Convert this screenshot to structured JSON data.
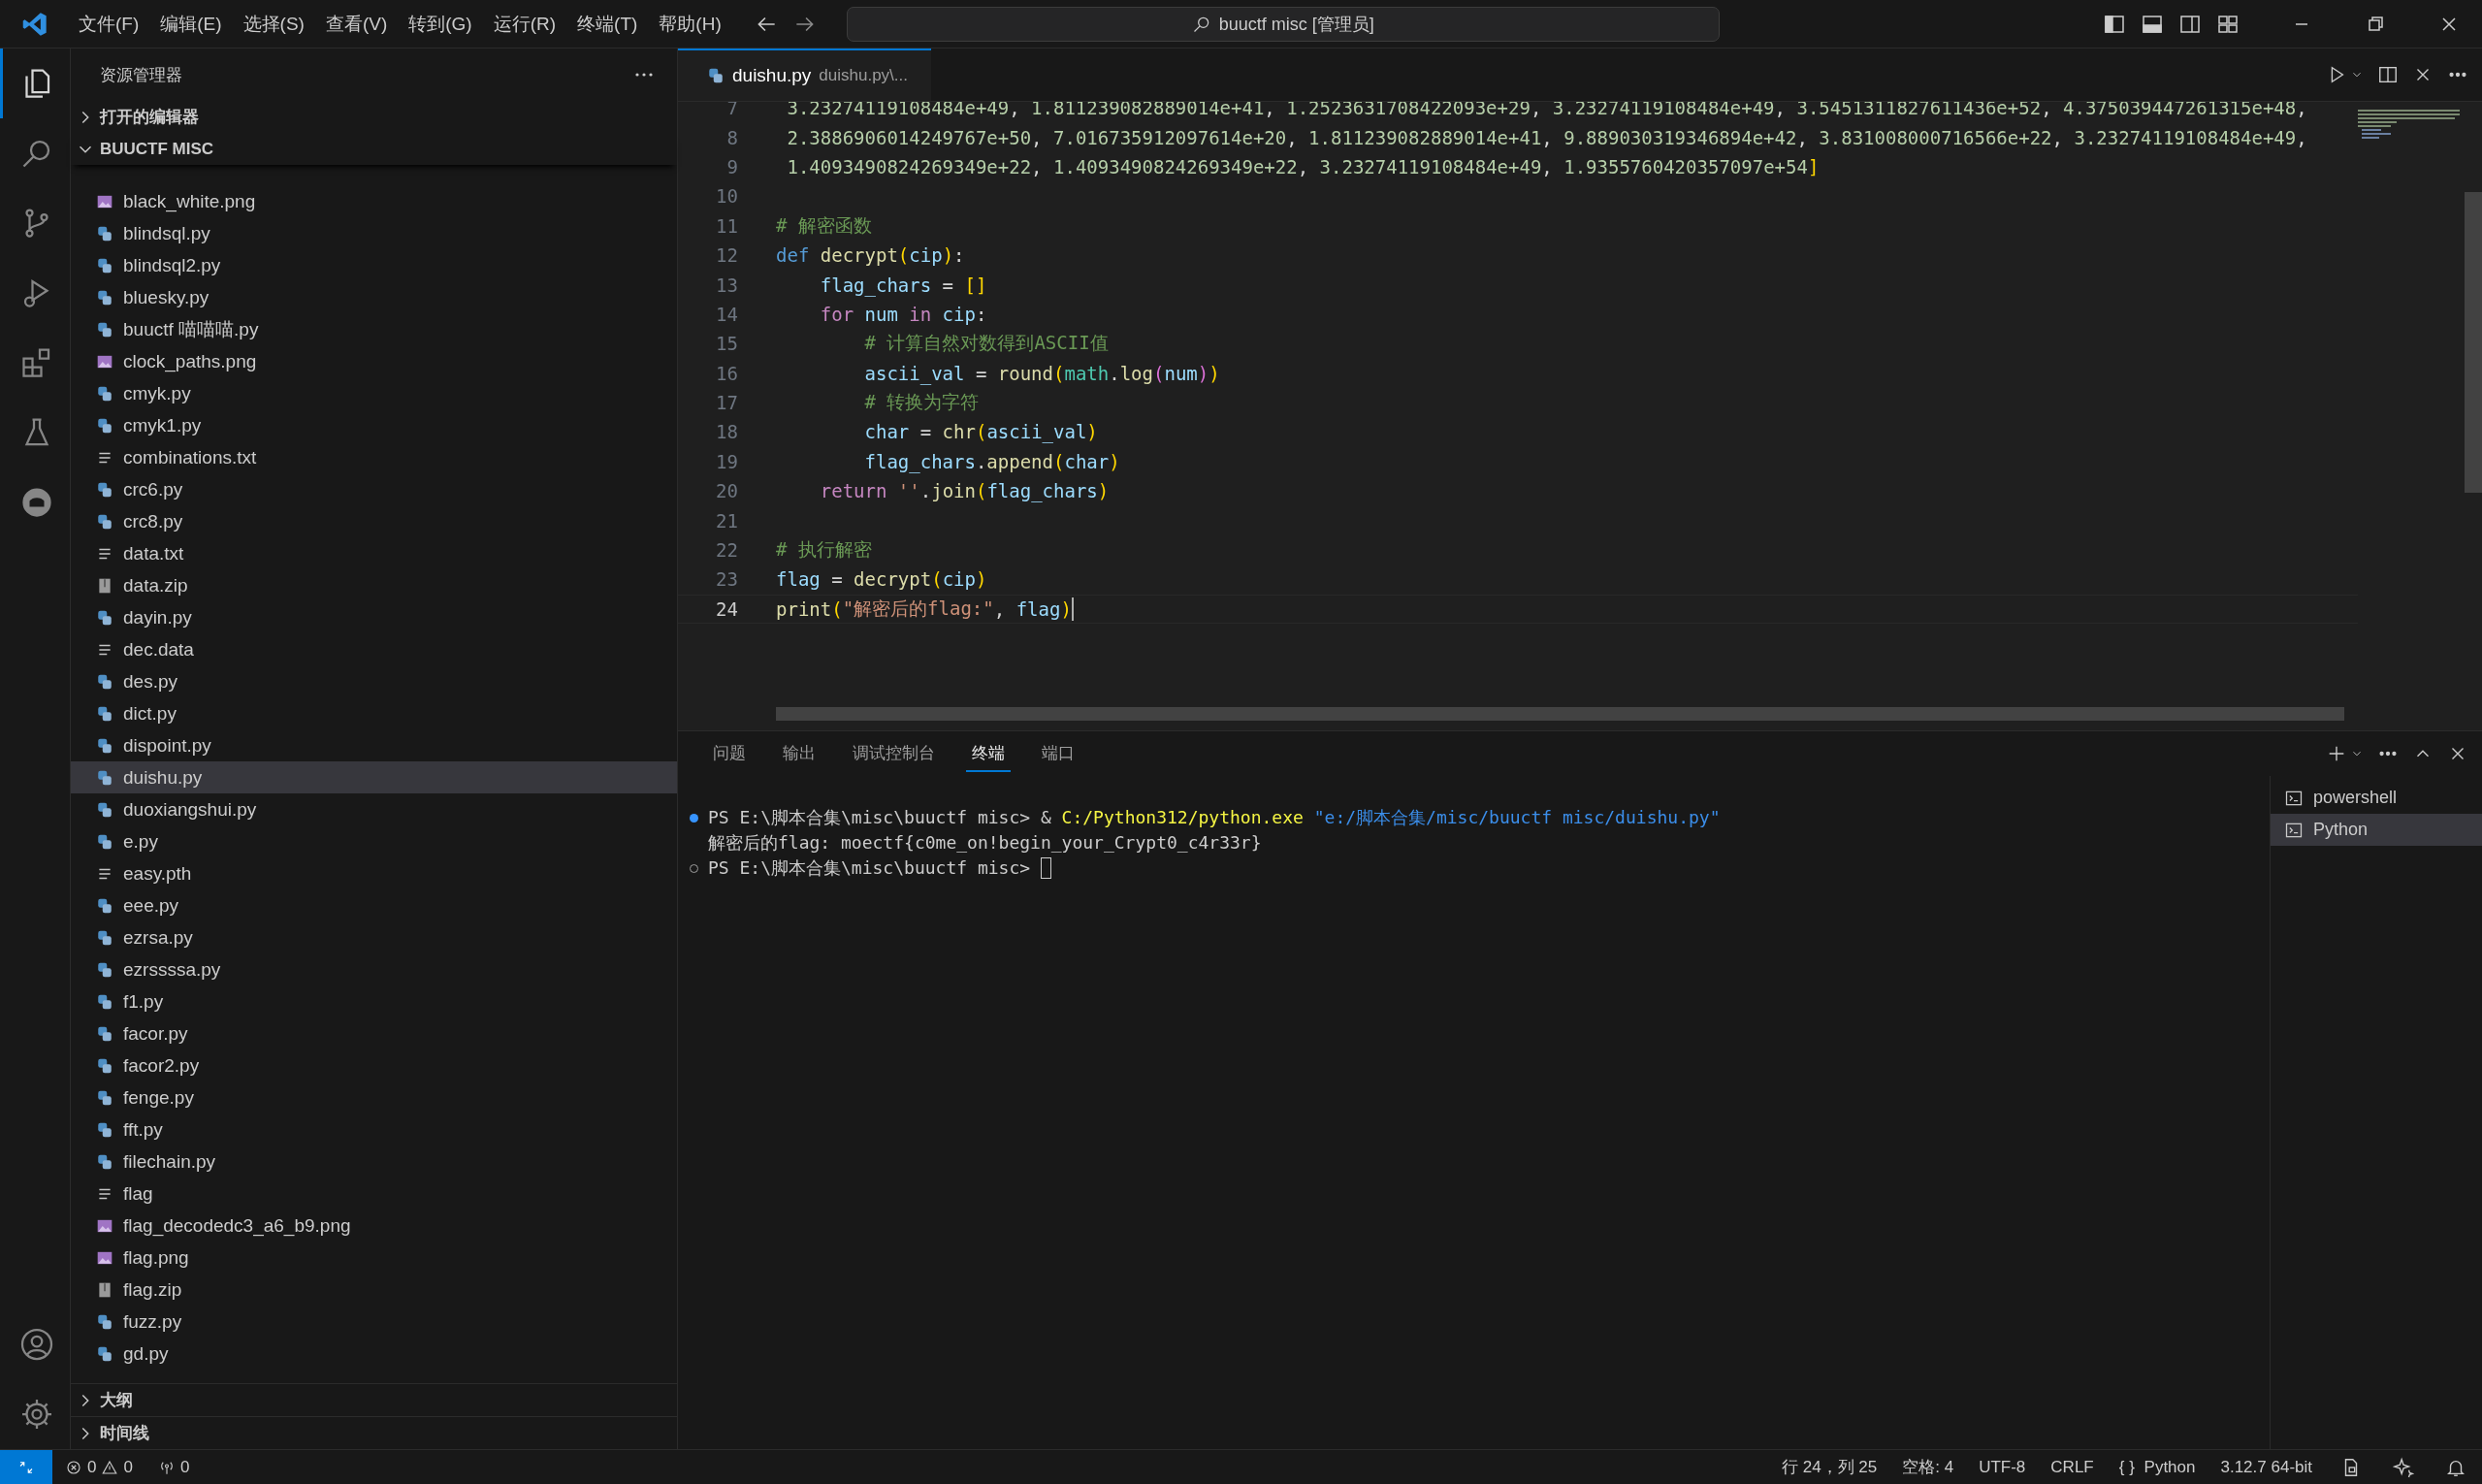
{
  "title_bar": {
    "menu": [
      "文件(F)",
      "编辑(E)",
      "选择(S)",
      "查看(V)",
      "转到(G)",
      "运行(R)",
      "终端(T)",
      "帮助(H)"
    ],
    "search": "buuctf misc [管理员]"
  },
  "activity_bar": {
    "items": [
      {
        "selected": true
      },
      {
        "selected": false
      },
      {
        "selected": false
      },
      {
        "selected": false
      },
      {
        "selected": false
      },
      {
        "selected": false
      },
      {
        "selected": false
      }
    ]
  },
  "sidebar": {
    "title": "资源管理器",
    "sections": [
      {
        "label": "打开的编辑器",
        "expanded": false
      },
      {
        "label": "BUUCTF MISC",
        "expanded": true
      }
    ],
    "files": [
      {
        "name": "black_white.png",
        "kind": "png",
        "selected": false
      },
      {
        "name": "blindsql.py",
        "kind": "py",
        "selected": false
      },
      {
        "name": "blindsql2.py",
        "kind": "py",
        "selected": false
      },
      {
        "name": "bluesky.py",
        "kind": "py",
        "selected": false
      },
      {
        "name": "buuctf 喵喵喵.py",
        "kind": "py",
        "selected": false
      },
      {
        "name": "clock_paths.png",
        "kind": "png",
        "selected": false
      },
      {
        "name": "cmyk.py",
        "kind": "py",
        "selected": false
      },
      {
        "name": "cmyk1.py",
        "kind": "py",
        "selected": false
      },
      {
        "name": "combinations.txt",
        "kind": "txt",
        "selected": false
      },
      {
        "name": "crc6.py",
        "kind": "py",
        "selected": false
      },
      {
        "name": "crc8.py",
        "kind": "py",
        "selected": false
      },
      {
        "name": "data.txt",
        "kind": "txt",
        "selected": false
      },
      {
        "name": "data.zip",
        "kind": "zip",
        "selected": false
      },
      {
        "name": "dayin.py",
        "kind": "py",
        "selected": false
      },
      {
        "name": "dec.data",
        "kind": "txt",
        "selected": false
      },
      {
        "name": "des.py",
        "kind": "py",
        "selected": false
      },
      {
        "name": "dict.py",
        "kind": "py",
        "selected": false
      },
      {
        "name": "dispoint.py",
        "kind": "py",
        "selected": false
      },
      {
        "name": "duishu.py",
        "kind": "py",
        "selected": true
      },
      {
        "name": "duoxiangshui.py",
        "kind": "py",
        "selected": false
      },
      {
        "name": "e.py",
        "kind": "py",
        "selected": false
      },
      {
        "name": "easy.pth",
        "kind": "txt",
        "selected": false
      },
      {
        "name": "eee.py",
        "kind": "py",
        "selected": false
      },
      {
        "name": "ezrsa.py",
        "kind": "py",
        "selected": false
      },
      {
        "name": "ezrssssa.py",
        "kind": "py",
        "selected": false
      },
      {
        "name": "f1.py",
        "kind": "py",
        "selected": false
      },
      {
        "name": "facor.py",
        "kind": "py",
        "selected": false
      },
      {
        "name": "facor2.py",
        "kind": "py",
        "selected": false
      },
      {
        "name": "fenge.py",
        "kind": "py",
        "selected": false
      },
      {
        "name": "fft.py",
        "kind": "py",
        "selected": false
      },
      {
        "name": "filechain.py",
        "kind": "py",
        "selected": false
      },
      {
        "name": "flag",
        "kind": "txt",
        "selected": false
      },
      {
        "name": "flag_decodedc3_a6_b9.png",
        "kind": "png",
        "selected": false
      },
      {
        "name": "flag.png",
        "kind": "png",
        "selected": false
      },
      {
        "name": "flag.zip",
        "kind": "zip",
        "selected": false
      },
      {
        "name": "fuzz.py",
        "kind": "py",
        "selected": false
      },
      {
        "name": "gd.py",
        "kind": "py",
        "selected": false
      }
    ],
    "bottom_sections": [
      {
        "label": "大纲",
        "expanded": false
      },
      {
        "label": "时间线",
        "expanded": false
      }
    ]
  },
  "editor": {
    "tab": {
      "label": "duishu.py",
      "description": "duishu.py\\...",
      "selected": true
    },
    "lines": [
      {
        "number": "7",
        "active": false,
        "tokens": [
          {
            "kind": "num",
            "text": " 3.23274119108484e+49"
          },
          {
            "kind": "plain",
            "text": ", "
          },
          {
            "kind": "num",
            "text": "1.811239082889014e+41"
          },
          {
            "kind": "plain",
            "text": ", "
          },
          {
            "kind": "num",
            "text": "1.2523631708422093e+29"
          },
          {
            "kind": "plain",
            "text": ", "
          },
          {
            "kind": "num",
            "text": "3.23274119108484e+49"
          },
          {
            "kind": "plain",
            "text": ", "
          },
          {
            "kind": "num",
            "text": "3.5451311827611436e+52"
          },
          {
            "kind": "plain",
            "text": ", "
          },
          {
            "kind": "num",
            "text": "4.375039447261315e+48"
          },
          {
            "kind": "plain",
            "text": ","
          }
        ]
      },
      {
        "number": "8",
        "active": false,
        "tokens": [
          {
            "kind": "num",
            "text": " 2.3886906014249767e+50"
          },
          {
            "kind": "plain",
            "text": ", "
          },
          {
            "kind": "num",
            "text": "7.016735912097614e+20"
          },
          {
            "kind": "plain",
            "text": ", "
          },
          {
            "kind": "num",
            "text": "1.811239082889014e+41"
          },
          {
            "kind": "plain",
            "text": ", "
          },
          {
            "kind": "num",
            "text": "9.889030319346894e+42"
          },
          {
            "kind": "plain",
            "text": ", "
          },
          {
            "kind": "num",
            "text": "3.831008000716566e+22"
          },
          {
            "kind": "plain",
            "text": ", "
          },
          {
            "kind": "num",
            "text": "3.23274119108484e+49"
          },
          {
            "kind": "plain",
            "text": ","
          }
        ]
      },
      {
        "number": "9",
        "active": false,
        "tokens": [
          {
            "kind": "num",
            "text": " 1.4093490824269349e+22"
          },
          {
            "kind": "plain",
            "text": ", "
          },
          {
            "kind": "num",
            "text": "1.4093490824269349e+22"
          },
          {
            "kind": "plain",
            "text": ", "
          },
          {
            "kind": "num",
            "text": "3.23274119108484e+49"
          },
          {
            "kind": "plain",
            "text": ", "
          },
          {
            "kind": "num",
            "text": "1.9355760420357097e+54"
          },
          {
            "kind": "br1",
            "text": "]"
          }
        ]
      },
      {
        "number": "10",
        "active": false
      },
      {
        "number": "11",
        "active": false,
        "tokens": [
          {
            "kind": "comment",
            "text": "# 解密函数"
          }
        ]
      },
      {
        "number": "12",
        "active": false,
        "tokens": [
          {
            "kind": "kw",
            "text": "def "
          },
          {
            "kind": "fn",
            "text": "decrypt"
          },
          {
            "kind": "br1",
            "text": "("
          },
          {
            "kind": "var",
            "text": "cip"
          },
          {
            "kind": "br1",
            "text": ")"
          },
          {
            "kind": "plain",
            "text": ":"
          }
        ]
      },
      {
        "number": "13",
        "active": false,
        "tokens": [
          {
            "kind": "var",
            "text": "    flag_chars"
          },
          {
            "kind": "plain",
            "text": " = "
          },
          {
            "kind": "br1",
            "text": "[]"
          }
        ]
      },
      {
        "number": "14",
        "active": false,
        "tokens": [
          {
            "kind": "ctrl",
            "text": "    for "
          },
          {
            "kind": "var",
            "text": "num "
          },
          {
            "kind": "ctrl",
            "text": "in "
          },
          {
            "kind": "var",
            "text": "cip"
          },
          {
            "kind": "plain",
            "text": ":"
          }
        ]
      },
      {
        "number": "15",
        "active": false,
        "tokens": [
          {
            "kind": "comment",
            "text": "        # 计算自然对数得到ASCII值"
          }
        ]
      },
      {
        "number": "16",
        "active": false,
        "tokens": [
          {
            "kind": "var",
            "text": "        ascii_val"
          },
          {
            "kind": "plain",
            "text": " = "
          },
          {
            "kind": "fn",
            "text": "round"
          },
          {
            "kind": "br1",
            "text": "("
          },
          {
            "kind": "cls",
            "text": "math"
          },
          {
            "kind": "plain",
            "text": "."
          },
          {
            "kind": "fn",
            "text": "log"
          },
          {
            "kind": "br2",
            "text": "("
          },
          {
            "kind": "var",
            "text": "num"
          },
          {
            "kind": "br2",
            "text": ")"
          },
          {
            "kind": "br1",
            "text": ")"
          }
        ]
      },
      {
        "number": "17",
        "active": false,
        "tokens": [
          {
            "kind": "comment",
            "text": "        # 转换为字符"
          }
        ]
      },
      {
        "number": "18",
        "active": false,
        "tokens": [
          {
            "kind": "var",
            "text": "        char"
          },
          {
            "kind": "plain",
            "text": " = "
          },
          {
            "kind": "fn",
            "text": "chr"
          },
          {
            "kind": "br1",
            "text": "("
          },
          {
            "kind": "var",
            "text": "ascii_val"
          },
          {
            "kind": "br1",
            "text": ")"
          }
        ]
      },
      {
        "number": "19",
        "active": false,
        "tokens": [
          {
            "kind": "var",
            "text": "        flag_chars"
          },
          {
            "kind": "plain",
            "text": "."
          },
          {
            "kind": "fn",
            "text": "append"
          },
          {
            "kind": "br1",
            "text": "("
          },
          {
            "kind": "var",
            "text": "char"
          },
          {
            "kind": "br1",
            "text": ")"
          }
        ]
      },
      {
        "number": "20",
        "active": false,
        "tokens": [
          {
            "kind": "ctrl",
            "text": "    return "
          },
          {
            "kind": "str",
            "text": "''"
          },
          {
            "kind": "plain",
            "text": "."
          },
          {
            "kind": "fn",
            "text": "join"
          },
          {
            "kind": "br1",
            "text": "("
          },
          {
            "kind": "var",
            "text": "flag_chars"
          },
          {
            "kind": "br1",
            "text": ")"
          }
        ]
      },
      {
        "number": "21",
        "active": false
      },
      {
        "number": "22",
        "active": false,
        "tokens": [
          {
            "kind": "comment",
            "text": "# 执行解密"
          }
        ]
      },
      {
        "number": "23",
        "active": false,
        "tokens": [
          {
            "kind": "var",
            "text": "flag"
          },
          {
            "kind": "plain",
            "text": " = "
          },
          {
            "kind": "fn",
            "text": "decrypt"
          },
          {
            "kind": "br1",
            "text": "("
          },
          {
            "kind": "var",
            "text": "cip"
          },
          {
            "kind": "br1",
            "text": ")"
          }
        ]
      },
      {
        "number": "24",
        "active": true,
        "tokens": [
          {
            "kind": "fn",
            "text": "print"
          },
          {
            "kind": "br1",
            "text": "("
          },
          {
            "kind": "str",
            "text": "\"解密后的flag:\""
          },
          {
            "kind": "plain",
            "text": ", "
          },
          {
            "kind": "var",
            "text": "flag"
          },
          {
            "kind": "br1",
            "text": ")"
          }
        ]
      }
    ]
  },
  "panel": {
    "tabs": [
      {
        "label": "问题",
        "selected": false
      },
      {
        "label": "输出",
        "selected": false
      },
      {
        "label": "调试控制台",
        "selected": false
      },
      {
        "label": "终端",
        "selected": true
      },
      {
        "label": "端口",
        "selected": false
      }
    ],
    "terminal": [
      {
        "kind": "success",
        "cursor": false,
        "tokens": [
          {
            "kind": "plain",
            "text": "PS E:\\脚本合集\\misc\\buuctf misc> & "
          },
          {
            "kind": "path",
            "text": "C:/Python312/python.exe "
          },
          {
            "kind": "str",
            "text": "\"e:/脚本合集/misc/buuctf misc/duishu.py\""
          }
        ]
      },
      {
        "kind": "output",
        "cursor": false,
        "tokens": [
          {
            "kind": "plain",
            "text": "解密后的flag: moectf{c0me_on!begin_your_Crypt0_c4r33r}"
          }
        ]
      },
      {
        "kind": "pending",
        "cursor": true,
        "tokens": [
          {
            "kind": "plain",
            "text": "PS E:\\脚本合集\\misc\\buuctf misc>"
          }
        ]
      }
    ],
    "sessions": [
      {
        "label": "powershell",
        "selected": false
      },
      {
        "label": "Python",
        "selected": true
      }
    ]
  },
  "status_bar": {
    "errors": "0",
    "warnings": "0",
    "ports": "0",
    "items": [
      {
        "kind": "text",
        "text": "行 24，列 25"
      },
      {
        "kind": "text",
        "text": "空格: 4"
      },
      {
        "kind": "text",
        "text": "UTF-8"
      },
      {
        "kind": "text",
        "text": "CRLF"
      },
      {
        "kind": "language",
        "glyph": "{ }",
        "text": "Python"
      },
      {
        "kind": "text",
        "text": "3.12.7 64-bit"
      }
    ]
  }
}
